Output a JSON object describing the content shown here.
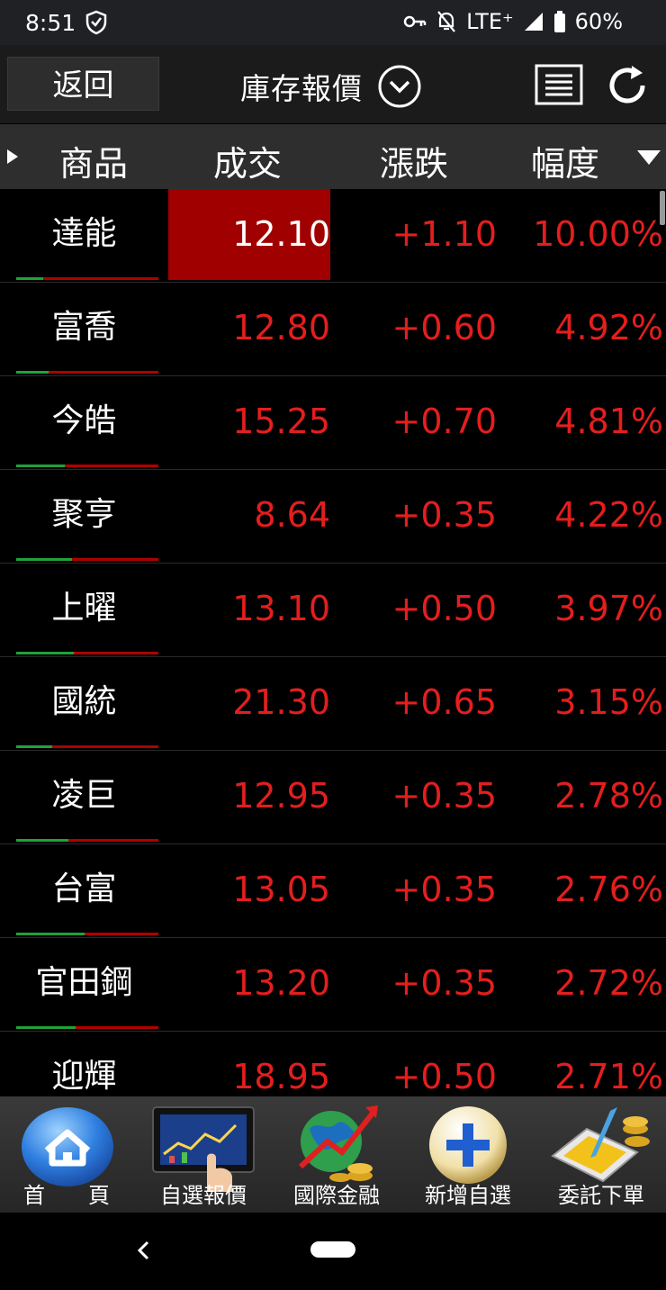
{
  "status_bar": {
    "time": "8:51",
    "network": "LTE⁺",
    "battery": "60%"
  },
  "toolbar": {
    "back_label": "返回",
    "title": "庫存報價"
  },
  "columns": {
    "product": "商品",
    "price": "成交",
    "change": "漲跌",
    "percent": "幅度"
  },
  "rows": [
    {
      "name": "達能",
      "price": "12.10",
      "change": "+1.10",
      "pct": "10.00%"
    },
    {
      "name": "富喬",
      "price": "12.80",
      "change": "+0.60",
      "pct": "4.92%"
    },
    {
      "name": "今皓",
      "price": "15.25",
      "change": "+0.70",
      "pct": "4.81%"
    },
    {
      "name": "聚亨",
      "price": "8.64",
      "change": "+0.35",
      "pct": "4.22%"
    },
    {
      "name": "上曜",
      "price": "13.10",
      "change": "+0.50",
      "pct": "3.97%"
    },
    {
      "name": "國統",
      "price": "21.30",
      "change": "+0.65",
      "pct": "3.15%"
    },
    {
      "name": "凌巨",
      "price": "12.95",
      "change": "+0.35",
      "pct": "2.78%"
    },
    {
      "name": "台富",
      "price": "13.05",
      "change": "+0.35",
      "pct": "2.76%"
    },
    {
      "name": "官田鋼",
      "price": "13.20",
      "change": "+0.35",
      "pct": "2.72%"
    },
    {
      "name": "迎輝",
      "price": "18.95",
      "change": "+0.50",
      "pct": "2.71%"
    }
  ],
  "bottom_nav": {
    "home": "首　　頁",
    "watchlist": "自選報價",
    "intl": "國際金融",
    "add": "新增自選",
    "order": "委託下單"
  },
  "colors": {
    "up": "#e41e1e",
    "highlight": "#a00000",
    "bar_green": "#1fa23b",
    "bar_red": "#b00000"
  },
  "icons": [
    "shield-icon",
    "key-icon",
    "mute-bell-icon",
    "signal-icon",
    "battery-icon",
    "chevron-down-circle-icon",
    "list-icon",
    "refresh-icon",
    "sort-down-icon",
    "home-icon",
    "tablet-chart-icon",
    "globe-money-icon",
    "plus-circle-icon",
    "order-tablet-icon"
  ]
}
